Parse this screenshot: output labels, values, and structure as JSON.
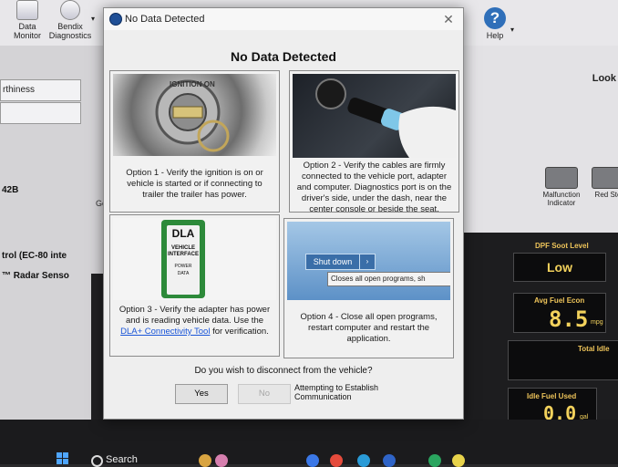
{
  "app": {
    "toolbar": {
      "data_monitor_label": "Data\nMonitor",
      "bendix_label": "Bendix\nDiagnostics",
      "help_label": "Help",
      "help_glyph": "?"
    },
    "left_panel": {
      "field1": "rthiness",
      "item_442b": "42B",
      "item_ctrl": "trol (EC-80 inte",
      "item_radar": "™ Radar Senso",
      "ge_label": "Ge"
    },
    "right_panel": {
      "look_label": "Look",
      "malfunction_label": "Malfunction Indicator",
      "red_stop_label": "Red Sto"
    },
    "dashboard": {
      "dpf_title": "DPF Soot Level",
      "dpf_value": "Low",
      "fuel_econ_title": "Avg Fuel Econ",
      "fuel_econ_value": "8.5",
      "fuel_econ_unit": "mpg",
      "total_idle_title": "Total Idle",
      "idle_fuel_title": "Idle Fuel Used",
      "idle_fuel_value": "0.0",
      "idle_fuel_unit": "gal"
    },
    "taskbar": {
      "search_label": "Search"
    }
  },
  "dialog": {
    "title": "No Data Detected",
    "heading": "No Data Detected",
    "close_glyph": "✕",
    "option1_text": "Option 1 - Verify the ignition is on or vehicle is started or if connecting to trailer the trailer has power.",
    "option2_text": "Option 2 - Verify the cables are firmly connected to the vehicle port, adapter and computer.  Diagnostics port is on the driver's side, under the dash, near the center console or beside the seat.",
    "option3_text_a": "Option 3 - Verify the adapter has power and is reading vehicle data. Use the ",
    "option3_link": "DLA+ Connectivity Tool",
    "option3_text_b": " for verification.",
    "option4_text": "Option 4 - Close all open programs, restart computer and restart the application.",
    "option1_image_text": "IGNITION ON",
    "option3_image_title": "DLA",
    "option3_image_sub": "VEHICLE INTERFACE",
    "option3_image_power": "POWER",
    "option3_image_data": "DATA",
    "option4_image_button": "Shut down",
    "option4_image_tooltip": "Closes all open programs, sh",
    "question": "Do you wish to disconnect from the vehicle?",
    "yes_label": "Yes",
    "no_label": "No",
    "status_text": "Attempting to Establish Communication"
  }
}
